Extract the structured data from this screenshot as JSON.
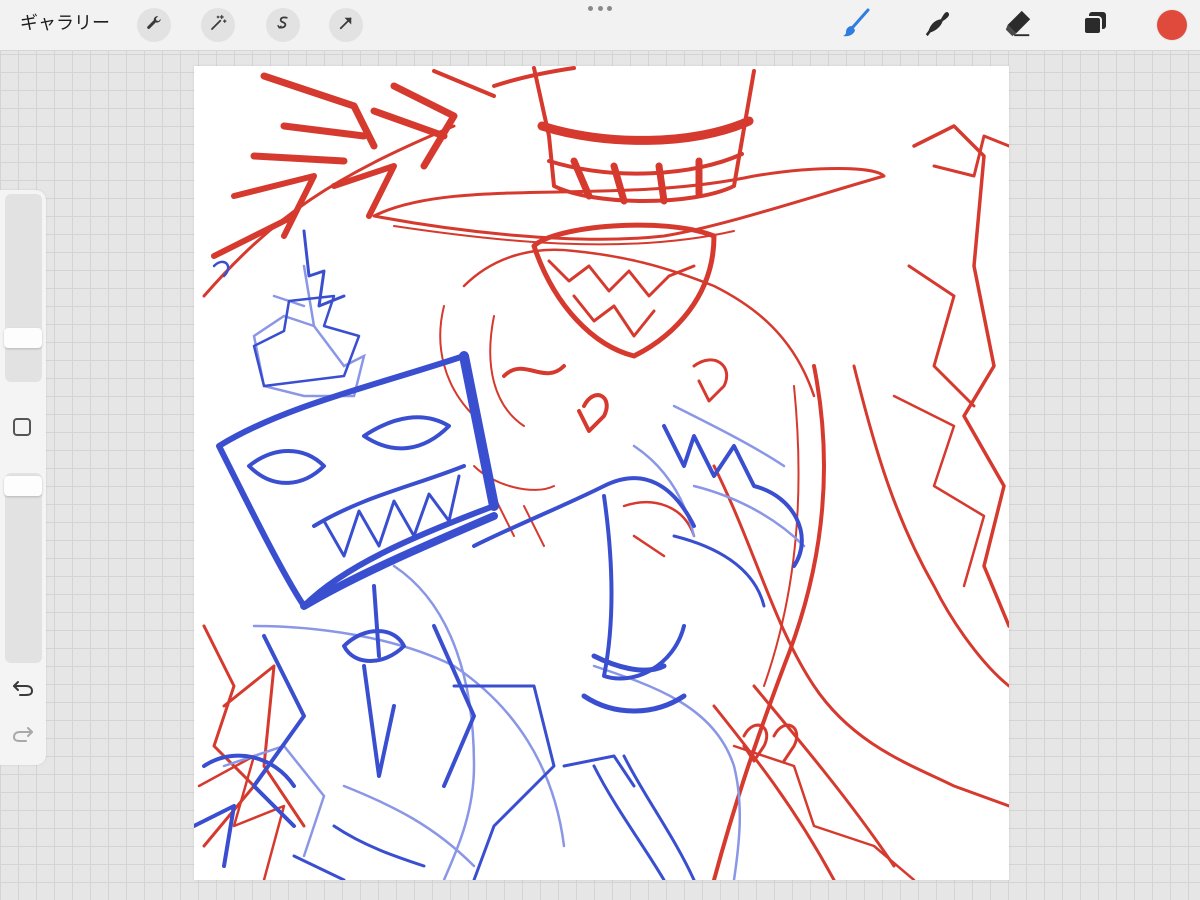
{
  "toolbar": {
    "gallery_label": "ギャラリー",
    "left_tools": [
      "wrench-icon",
      "magic-wand-icon",
      "selection-icon",
      "transform-arrow-icon"
    ],
    "right_tools": [
      "brush-icon",
      "smudge-icon",
      "eraser-icon",
      "layers-icon"
    ],
    "active_tool": "brush-icon",
    "current_color": "#e04a3c"
  },
  "sidebar": {
    "brush_size_level": 0.2,
    "opacity_level": 0.98,
    "icons": [
      "modify-square-icon",
      "undo-icon",
      "redo-icon"
    ]
  },
  "canvas": {
    "background": "#ffffff",
    "sketch_colors": [
      "#d63a2e",
      "#3a4fd0",
      "#8a96e6"
    ]
  }
}
